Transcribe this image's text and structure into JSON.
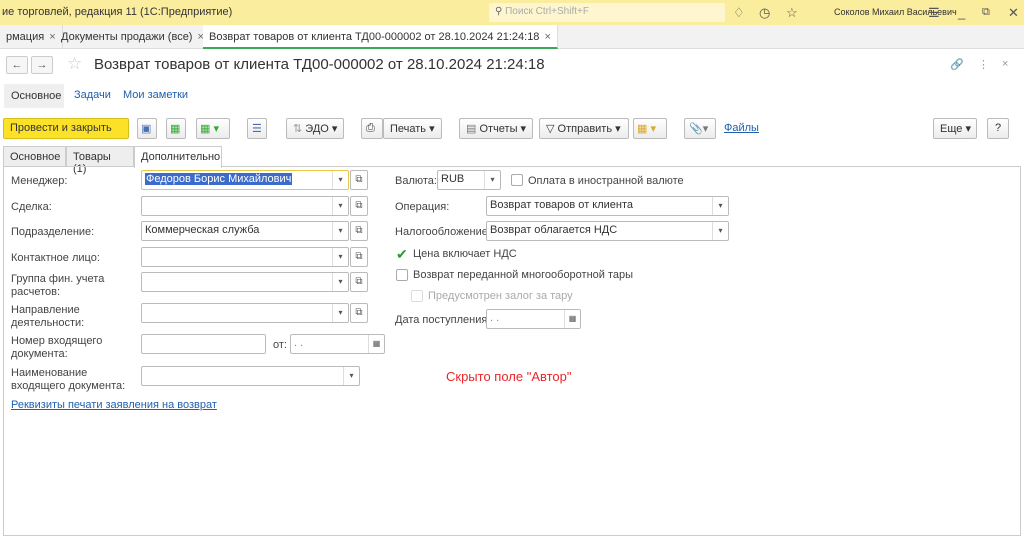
{
  "app": {
    "title": "ие торговлей, редакция 11  (1С:Предприятие)",
    "search_placeholder": "Поиск Ctrl+Shift+F",
    "user": "Соколов Михаил Васильевич"
  },
  "tabs": [
    {
      "label": "рмация"
    },
    {
      "label": "Документы продажи (все)"
    },
    {
      "label": "Возврат товаров от клиента ТД00-000002 от 28.10.2024 21:24:18"
    }
  ],
  "form": {
    "title": "Возврат товаров от клиента ТД00-000002 от 28.10.2024 21:24:18"
  },
  "subtabs": [
    "Основное",
    "Задачи",
    "Мои заметки"
  ],
  "toolbar": {
    "post_close": "Провести и закрыть",
    "edo": "ЭДО",
    "print": "Печать",
    "reports": "Отчеты",
    "send": "Отправить",
    "files": "Файлы",
    "more": "Еще",
    "help": "?"
  },
  "inner_tabs": [
    "Основное",
    "Товары (1)",
    "Дополнительно"
  ],
  "fields": {
    "manager": {
      "label": "Менеджер:",
      "value": "Федоров Борис Михайлович"
    },
    "deal": {
      "label": "Сделка:",
      "value": ""
    },
    "department": {
      "label": "Подразделение:",
      "value": "Коммерческая служба"
    },
    "contact": {
      "label": "Контактное лицо:",
      "value": ""
    },
    "fin_group": {
      "label": "Группа фин. учета расчетов:",
      "value": ""
    },
    "direction": {
      "label": "Направление деятельности:",
      "value": ""
    },
    "in_number": {
      "label": "Номер входящего документа:",
      "value": "",
      "from_label": "от:",
      "date": " .  ."
    },
    "in_name": {
      "label": "Наименование входящего документа:",
      "value": ""
    },
    "currency": {
      "label": "Валюта:",
      "value": "RUB"
    },
    "foreign": {
      "label": "Оплата в иностранной валюте",
      "checked": false
    },
    "operation": {
      "label": "Операция:",
      "value": "Возврат товаров от клиента"
    },
    "tax": {
      "label": "Налогообложение:",
      "value": "Возврат облагается НДС"
    },
    "price_vat": {
      "label": "Цена включает НДС",
      "checked": true
    },
    "return_tare": {
      "label": "Возврат переданной многооборотной тары",
      "checked": false
    },
    "deposit": {
      "label": "Предусмотрен залог за тару",
      "checked": false
    },
    "receipt_date": {
      "label": "Дата поступления:",
      "value": " .  ."
    }
  },
  "print_link": "Реквизиты печати заявления на возврат",
  "annotation": "Скрыто поле \"Автор\""
}
